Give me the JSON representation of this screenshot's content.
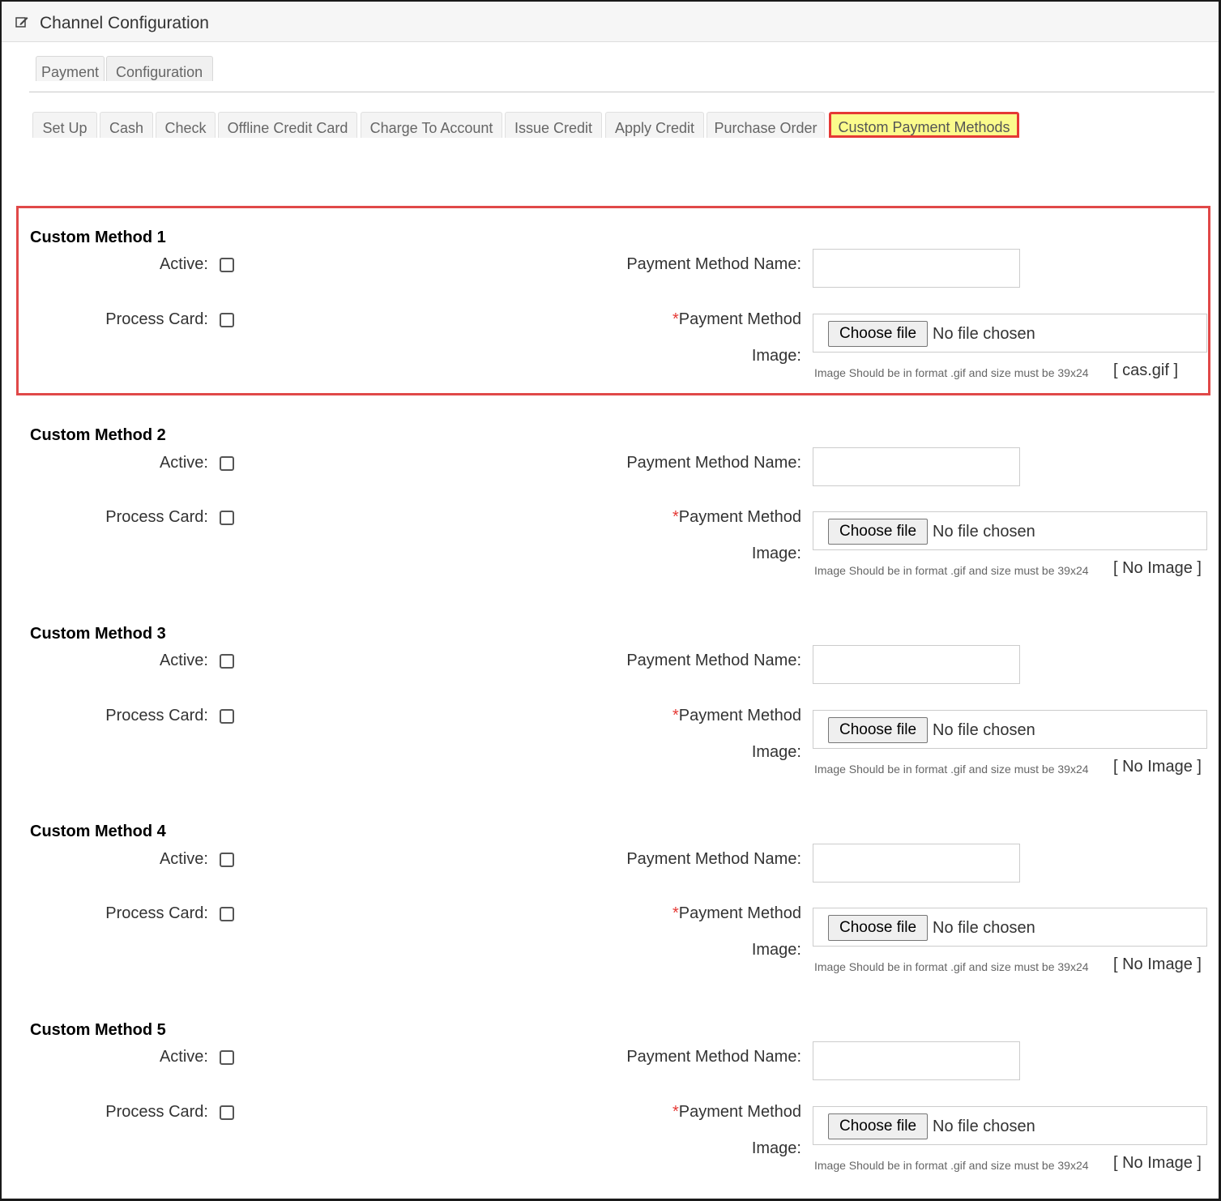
{
  "header": {
    "title": "Channel Configuration",
    "icon": "edit-icon"
  },
  "main_tabs": [
    {
      "label": "Payment",
      "active": true
    },
    {
      "label": "Configuration",
      "active": false
    }
  ],
  "sub_tabs": [
    {
      "label": "Set Up"
    },
    {
      "label": "Cash"
    },
    {
      "label": "Check"
    },
    {
      "label": "Offline Credit Card"
    },
    {
      "label": "Charge To Account"
    },
    {
      "label": "Issue Credit"
    },
    {
      "label": "Apply Credit"
    },
    {
      "label": "Purchase Order"
    },
    {
      "label": "Custom Payment Methods",
      "active": true
    }
  ],
  "labels": {
    "active": "Active:",
    "process_card": "Process Card:",
    "payment_method_name": "Payment Method Name:",
    "required_mark": "*",
    "payment_method_image_line1": "Payment Method",
    "payment_method_image_line2": "Image:",
    "choose_file": "Choose file",
    "no_file": "No file chosen",
    "hint": "Image Should be in format .gif and size must be 39x24"
  },
  "methods": [
    {
      "title": "Custom Method 1",
      "active": false,
      "process_card": false,
      "name": "",
      "current_image": "[ cas.gif ]"
    },
    {
      "title": "Custom Method 2",
      "active": false,
      "process_card": false,
      "name": "",
      "current_image": "[ No Image ]"
    },
    {
      "title": "Custom Method 3",
      "active": false,
      "process_card": false,
      "name": "",
      "current_image": "[ No Image ]"
    },
    {
      "title": "Custom Method 4",
      "active": false,
      "process_card": false,
      "name": "",
      "current_image": "[ No Image ]"
    },
    {
      "title": "Custom Method 5",
      "active": false,
      "process_card": false,
      "name": "",
      "current_image": "[ No Image ]"
    }
  ],
  "colors": {
    "highlight": "#fbfb8c",
    "callout_border": "#e04848",
    "required": "#e53935"
  }
}
